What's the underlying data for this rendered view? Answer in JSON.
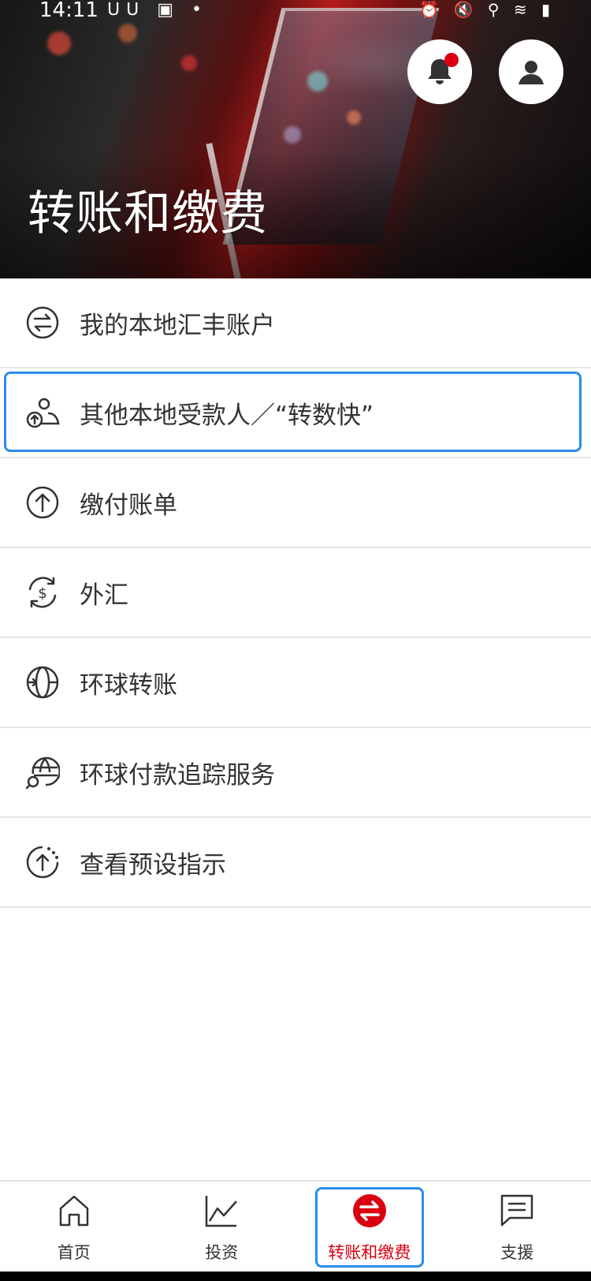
{
  "status_bar": {
    "time": "14:11",
    "left_icons": "ᑌᑌ ▣ •",
    "right_icons": "⏰ 🔇 ⚲ ≋ ▮"
  },
  "header": {
    "title": "转账和缴费",
    "notification_dot_color": "#db0011"
  },
  "menu": {
    "items": [
      {
        "label": "我的本地汇丰账户",
        "icon": "transfer-arrows-icon"
      },
      {
        "label": "其他本地受款人／“转数快”",
        "icon": "payee-person-icon"
      },
      {
        "label": "缴付账单",
        "icon": "arrow-up-circle-icon"
      },
      {
        "label": "外汇",
        "icon": "currency-exchange-icon"
      },
      {
        "label": "环球转账",
        "icon": "globe-transfer-icon"
      },
      {
        "label": "环球付款追踪服务",
        "icon": "globe-search-icon"
      },
      {
        "label": "查看预设指示",
        "icon": "scheduled-instruction-icon"
      }
    ]
  },
  "bottom_nav": {
    "items": [
      {
        "label": "首页",
        "icon": "home-icon"
      },
      {
        "label": "投资",
        "icon": "chart-icon"
      },
      {
        "label": "转账和缴费",
        "icon": "transfer-icon",
        "active": true
      },
      {
        "label": "支援",
        "icon": "chat-icon"
      }
    ]
  },
  "colors": {
    "accent": "#db0011",
    "focus": "#2a8de8"
  }
}
